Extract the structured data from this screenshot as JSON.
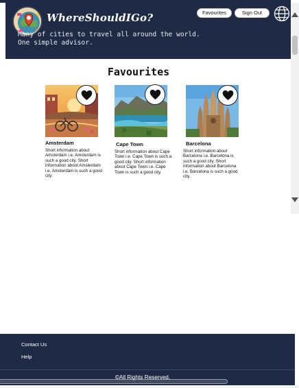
{
  "header": {
    "brand": "WhereShouldIGo?",
    "tagline": [
      "Many of cities to travel all around the world.",
      "One simple advisor."
    ],
    "nav": {
      "favourites_label": "Favourites",
      "sign_out_label": "Sign Out"
    },
    "icons": {
      "logo": "brand-logo-icon",
      "language": "globe-icon"
    }
  },
  "main": {
    "title": "Favourites",
    "cards": [
      {
        "name": "Amsterdam",
        "description": "Short information about Amsterdam i.e. Amsterdam is such a good city. Short information about Amsterdam i.e. Amsterdam is such a good city."
      },
      {
        "name": "Cape Town",
        "description": "Short information about Cape Town i.e. Cape Town is such a good city. Short information about Cape Town i.e. Cape Town is such a good city."
      },
      {
        "name": "Barcelona",
        "description": "Short information about Barcelona i.e. Barcelona is such a good city. Short information about Barcelona i.e. Barcelona is such a good city."
      }
    ]
  },
  "footer": {
    "links": [
      "Contact Us",
      "Help"
    ],
    "copyright": "©All Rights Reserved."
  },
  "colors": {
    "header_bg": "#1f2b45",
    "footer_bg": "#1f2b45",
    "button_bg": "#ffffff"
  }
}
